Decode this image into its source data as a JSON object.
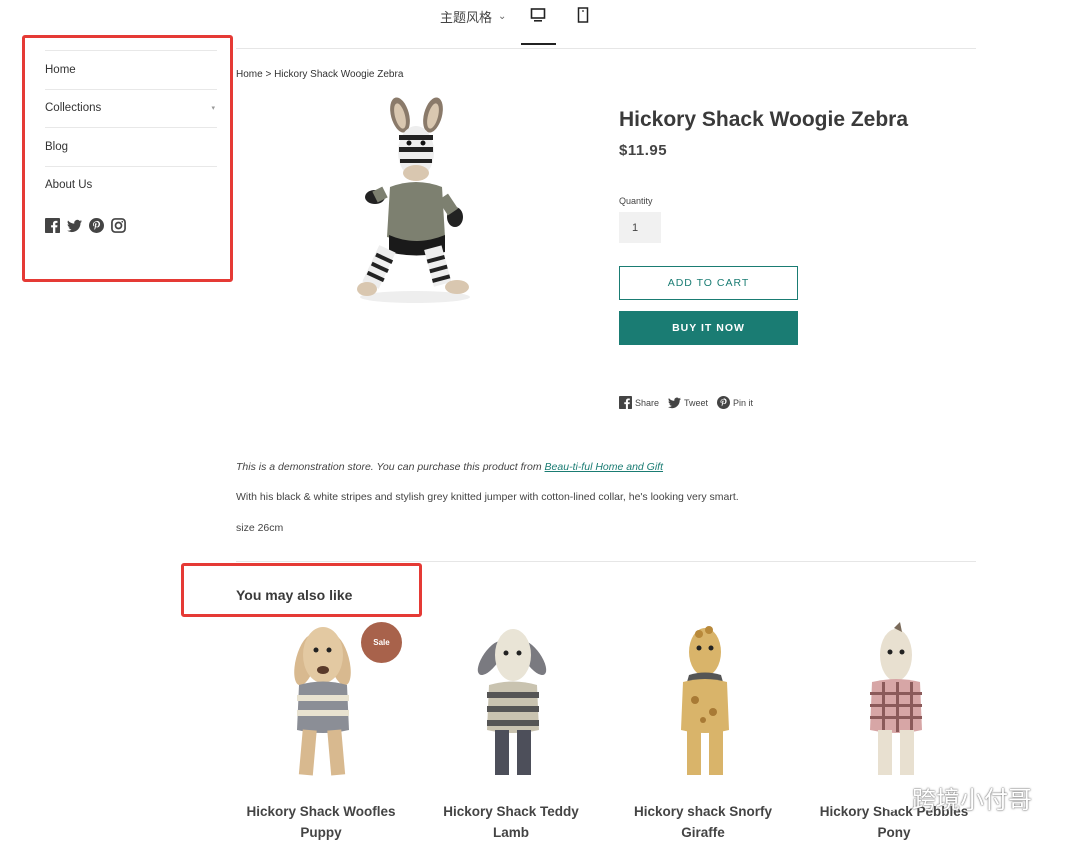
{
  "topbar": {
    "theme_label": "主题风格",
    "theme_chevron": "⌄"
  },
  "sidebar": {
    "items": [
      {
        "label": "Home"
      },
      {
        "label": "Collections",
        "caret": "▾"
      },
      {
        "label": "Blog"
      },
      {
        "label": "About Us"
      }
    ],
    "social_icons": [
      "facebook-icon",
      "twitter-icon",
      "pinterest-icon",
      "instagram-icon"
    ]
  },
  "breadcrumb": "Home > Hickory Shack Woogie Zebra",
  "product": {
    "title": "Hickory Shack Woogie Zebra",
    "price": "$11.95",
    "quantity_label": "Quantity",
    "quantity_value": "1",
    "add_to_cart": "ADD TO CART",
    "buy_now": "BUY IT NOW",
    "share": {
      "share": "Share",
      "tweet": "Tweet",
      "pin": "Pin it"
    }
  },
  "description": {
    "demo_prefix": "This is a demonstration store. You can purchase this product from ",
    "demo_link": "Beau-ti-ful Home and Gift",
    "body": "With his black & white stripes and stylish grey knitted jumper with cotton-lined collar, he's looking very smart.",
    "size": "size 26cm"
  },
  "related": {
    "title": "You may also like",
    "sale_badge": "Sale",
    "items": [
      {
        "name_line1": "Hickory Shack Woofles",
        "name_line2": "Puppy"
      },
      {
        "name_line1": "Hickory Shack Teddy",
        "name_line2": "Lamb"
      },
      {
        "name_line1": "Hickory shack Snorfy",
        "name_line2": "Giraffe"
      },
      {
        "name_line1": "Hickory Shack Pebbles",
        "name_line2": "Pony"
      }
    ]
  },
  "watermark": "跨境小付哥",
  "colors": {
    "accent": "#1a7c73",
    "highlight_box": "#e53a35",
    "sale": "#a8624b"
  }
}
